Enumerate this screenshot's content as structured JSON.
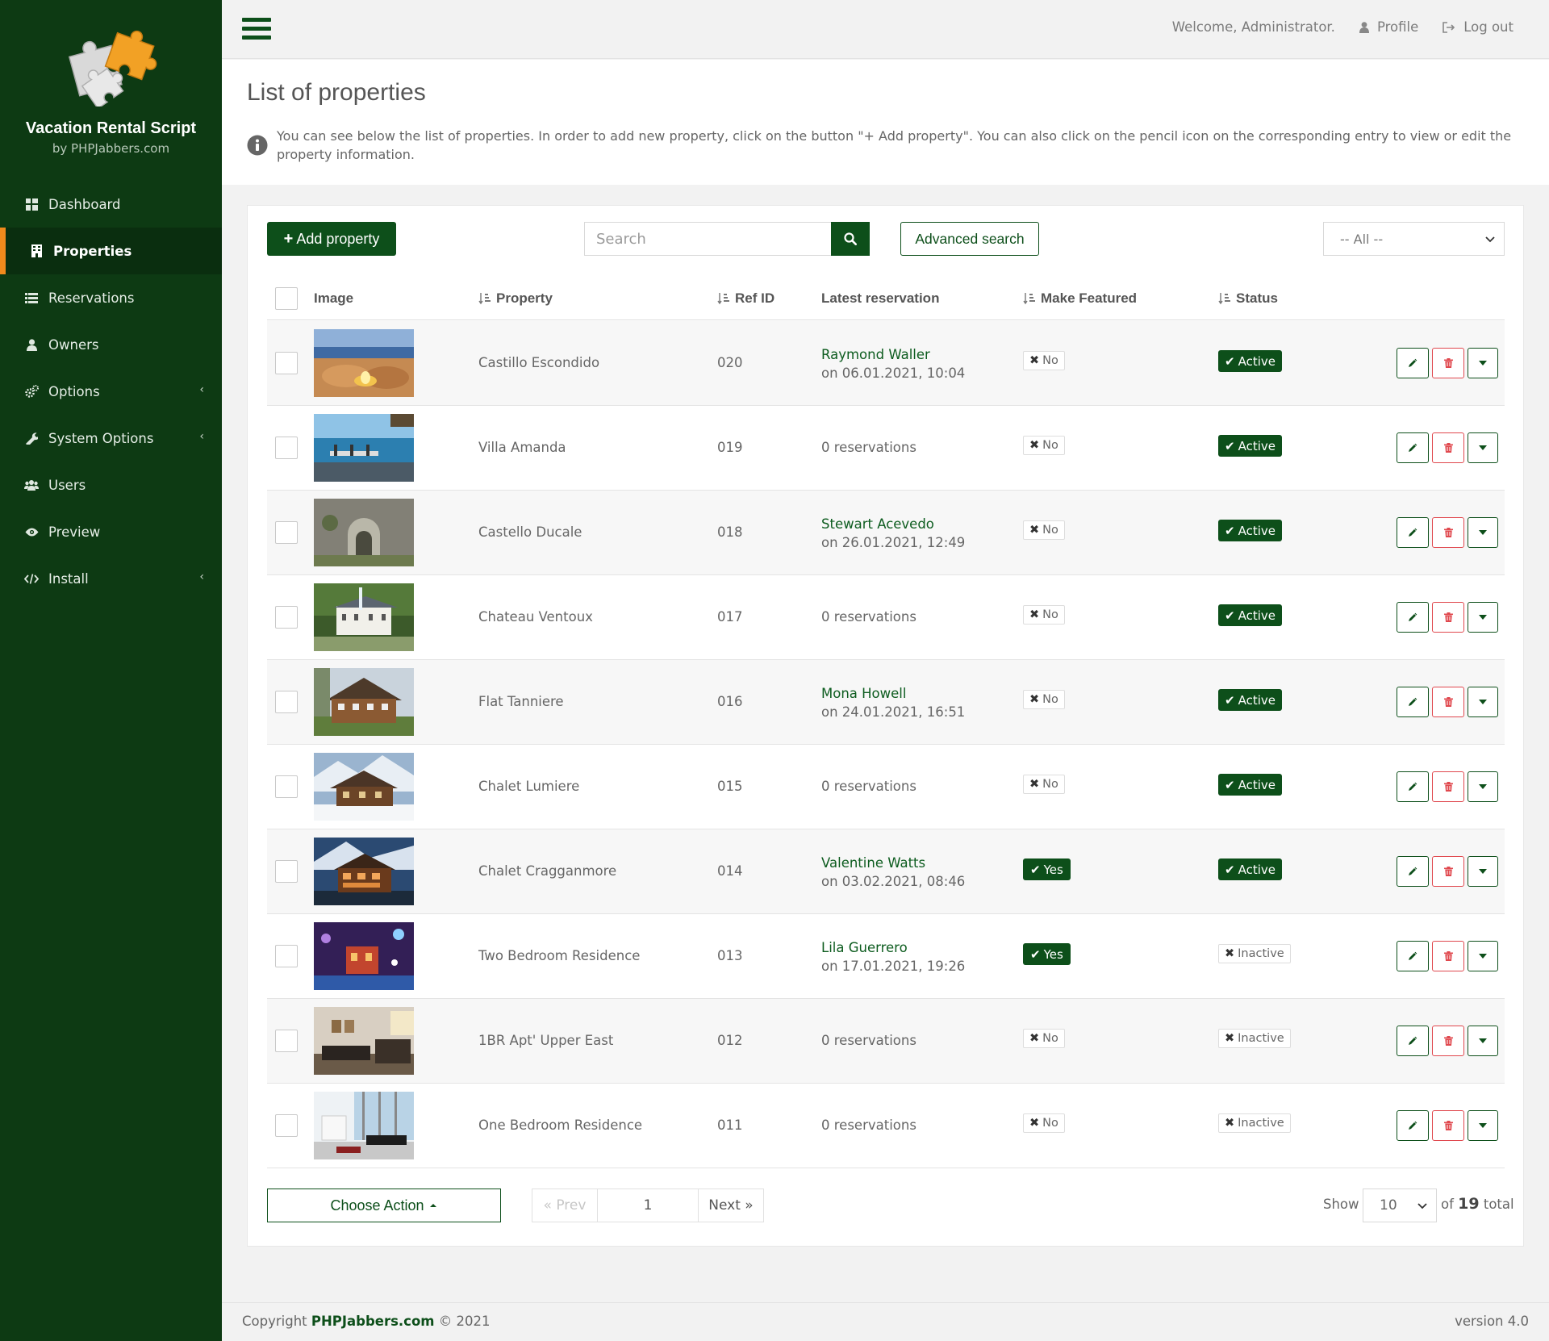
{
  "brand": {
    "title": "Vacation Rental Script",
    "subtitle": "by PHPJabbers.com"
  },
  "nav": [
    {
      "label": "Dashboard",
      "icon": "dashboard-icon",
      "active": false
    },
    {
      "label": "Properties",
      "icon": "building-icon",
      "active": true
    },
    {
      "label": "Reservations",
      "icon": "list-icon",
      "active": false
    },
    {
      "label": "Owners",
      "icon": "user-icon",
      "active": false
    },
    {
      "label": "Options",
      "icon": "cogs-icon",
      "active": false,
      "submenu": true
    },
    {
      "label": "System Options",
      "icon": "wrench-icon",
      "active": false,
      "submenu": true
    },
    {
      "label": "Users",
      "icon": "users-icon",
      "active": false
    },
    {
      "label": "Preview",
      "icon": "eye-icon",
      "active": false
    },
    {
      "label": "Install",
      "icon": "code-icon",
      "active": false,
      "submenu": true
    }
  ],
  "header": {
    "welcome": "Welcome, Administrator.",
    "profile": "Profile",
    "logout": "Log out"
  },
  "page": {
    "title": "List of properties",
    "info": "You can see below the list of properties. In order to add new property, click on the button \"+ Add property\". You can also click on the pencil icon on the corresponding entry to view or edit the property information."
  },
  "toolbar": {
    "add_label": "Add property",
    "search_placeholder": "Search",
    "advanced_label": "Advanced search",
    "filter_value": "-- All --"
  },
  "columns": {
    "image": "Image",
    "property": "Property",
    "ref": "Ref ID",
    "latest": "Latest reservation",
    "featured": "Make Featured",
    "status": "Status"
  },
  "rows": [
    {
      "name": "Castillo Escondido",
      "ref": "020",
      "guest": "Raymond Waller",
      "date": "on 06.01.2021, 10:04",
      "featured": "No",
      "status": "Active",
      "image": "fire-pit-terrace"
    },
    {
      "name": "Villa Amanda",
      "ref": "019",
      "guest": "",
      "date": "0 reservations",
      "featured": "No",
      "status": "Active",
      "image": "sea-dining"
    },
    {
      "name": "Castello Ducale",
      "ref": "018",
      "guest": "Stewart Acevedo",
      "date": "on 26.01.2021, 12:49",
      "featured": "No",
      "status": "Active",
      "image": "stone-gate"
    },
    {
      "name": "Chateau Ventoux",
      "ref": "017",
      "guest": "",
      "date": "0 reservations",
      "featured": "No",
      "status": "Active",
      "image": "white-chateau"
    },
    {
      "name": "Flat Tanniere",
      "ref": "016",
      "guest": "Mona Howell",
      "date": "on 24.01.2021, 16:51",
      "featured": "No",
      "status": "Active",
      "image": "wooden-chalet"
    },
    {
      "name": "Chalet Lumiere",
      "ref": "015",
      "guest": "",
      "date": "0 reservations",
      "featured": "No",
      "status": "Active",
      "image": "snow-chalet"
    },
    {
      "name": "Chalet Cragganmore",
      "ref": "014",
      "guest": "Valentine Watts",
      "date": "on 03.02.2021, 08:46",
      "featured": "Yes",
      "status": "Active",
      "image": "lit-chalet"
    },
    {
      "name": "Two Bedroom Residence",
      "ref": "013",
      "guest": "Lila Guerrero",
      "date": "on 17.01.2021, 19:26",
      "featured": "Yes",
      "status": "Inactive",
      "image": "night-lights"
    },
    {
      "name": "1BR Apt' Upper East",
      "ref": "012",
      "guest": "",
      "date": "0 reservations",
      "featured": "No",
      "status": "Inactive",
      "image": "living-room"
    },
    {
      "name": "One Bedroom Residence",
      "ref": "011",
      "guest": "",
      "date": "0 reservations",
      "featured": "No",
      "status": "Inactive",
      "image": "bright-apartment"
    }
  ],
  "footer_controls": {
    "choose_action": "Choose Action",
    "prev": "« Prev",
    "page": "1",
    "next": "Next »",
    "show_label": "Show",
    "per_page": "10",
    "of": "of",
    "total": "19",
    "total_suffix": "total"
  },
  "footer": {
    "copyright": "Copyright",
    "company": "PHPJabbers.com",
    "year": "© 2021",
    "version": "version 4.0"
  },
  "colors": {
    "sidebar": "#0d3a13",
    "primary": "#0d4f1a",
    "accent": "#f08a1c",
    "danger": "#e0484e"
  }
}
